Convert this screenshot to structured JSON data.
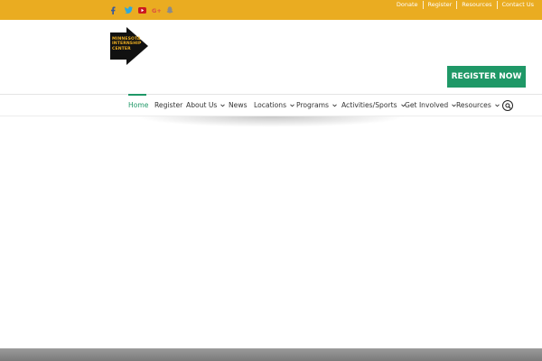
{
  "topbar": {
    "background": "#eaac21",
    "social_icons": [
      "facebook-icon",
      "twitter-icon",
      "youtube-icon",
      "google-plus-icon",
      "snapchat-icon"
    ],
    "links": [
      "Donate",
      "Register",
      "Resources",
      "Contact Us"
    ]
  },
  "logo": {
    "lines": [
      "MINNESOTA",
      "INTERNSHIP",
      "CENTER"
    ]
  },
  "cta": {
    "label": "REGISTER NOW",
    "color": "#1f9867"
  },
  "nav": {
    "items": [
      {
        "label": "Home"
      },
      {
        "label": "Register"
      },
      {
        "label": "About Us"
      },
      {
        "label": "News"
      },
      {
        "label": "Locations"
      },
      {
        "label": "Programs"
      },
      {
        "label": "Activities/Sports"
      },
      {
        "label": "Get Involved"
      },
      {
        "label": "Resources"
      }
    ],
    "active_color": "#1f9867"
  }
}
